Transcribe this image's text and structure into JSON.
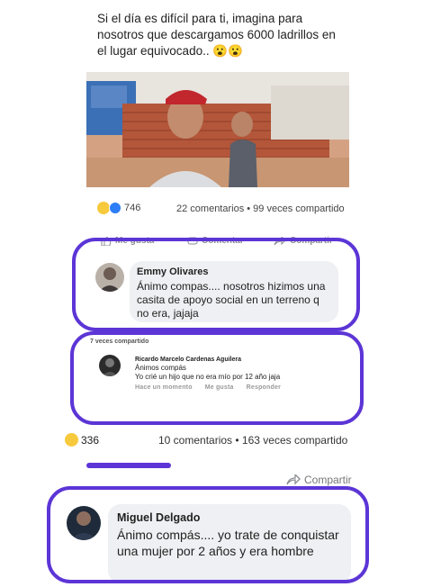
{
  "post": {
    "text": "Si el día es difícil para ti, imagina para nosotros que descargamos 6000 ladrillos en el lugar equivocado.. 😮😮",
    "reaction_count": "746",
    "stats_text": "22 comentarios • 99 veces compartido"
  },
  "actions": {
    "like": "Me gusta",
    "comment": "Comentar",
    "share": "Compartir"
  },
  "comment1": {
    "name": "Emmy Olivares",
    "text": "Ánimo compas.... nosotros hizimos una casita de apoyo social en un terreno q no era, jajaja"
  },
  "shared_section": {
    "label": "7 veces compartido",
    "name": "Ricardo Marcelo Cardenas Aguilera",
    "text": "Ánimos compás\nYo crié un hijo que no era mío por 12 año jaja",
    "time": "Hace un momento",
    "like": "Me gusta",
    "reply": "Responder"
  },
  "post2": {
    "reaction_count": "336",
    "stats_text": "10 comentarios • 163 veces compartido",
    "share_label": "Compartir"
  },
  "comment2": {
    "name": "Miguel Delgado",
    "text": "Ánimo compás.... yo trate de conquistar una mujer por 2 años y era hombre"
  },
  "colors": {
    "highlight": "#5c35d6",
    "bubble": "#eef0f3",
    "like_blue": "#2d7df6",
    "haha_yellow": "#f7c93d"
  }
}
